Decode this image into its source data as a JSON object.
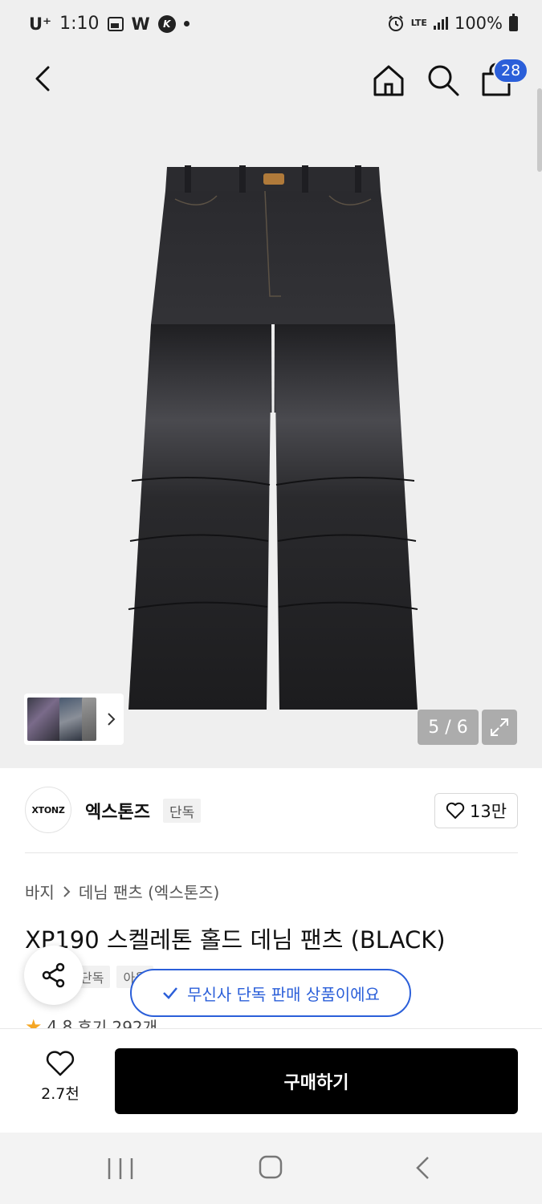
{
  "status_bar": {
    "carrier": "U⁺",
    "time": "1:10",
    "w_label": "W",
    "k_label": "K",
    "network": "LTE",
    "battery": "100%"
  },
  "nav": {
    "cart_count": "28"
  },
  "gallery": {
    "counter": "5 / 6"
  },
  "brand": {
    "logo_text": "XTONZ",
    "name": "엑스톤즈",
    "tag": "단독",
    "likes": "13만"
  },
  "product": {
    "breadcrumb": [
      "바지",
      "데님 팬츠 (엑스톤즈)"
    ],
    "title": "XP190 스켈레톤 홀드 데님 팬츠 (BLACK)",
    "tags": [
      "단독",
      "아울"
    ],
    "rating": "4.8",
    "reviews": "후기 292개"
  },
  "toast": {
    "message": "무신사 단독 판매 상품이에요"
  },
  "action_bar": {
    "wish_count": "2.7천",
    "buy_label": "구매하기"
  },
  "colors": {
    "accent": "#2b5fd9",
    "buy_button": "#000000",
    "star": "#f5a623"
  }
}
